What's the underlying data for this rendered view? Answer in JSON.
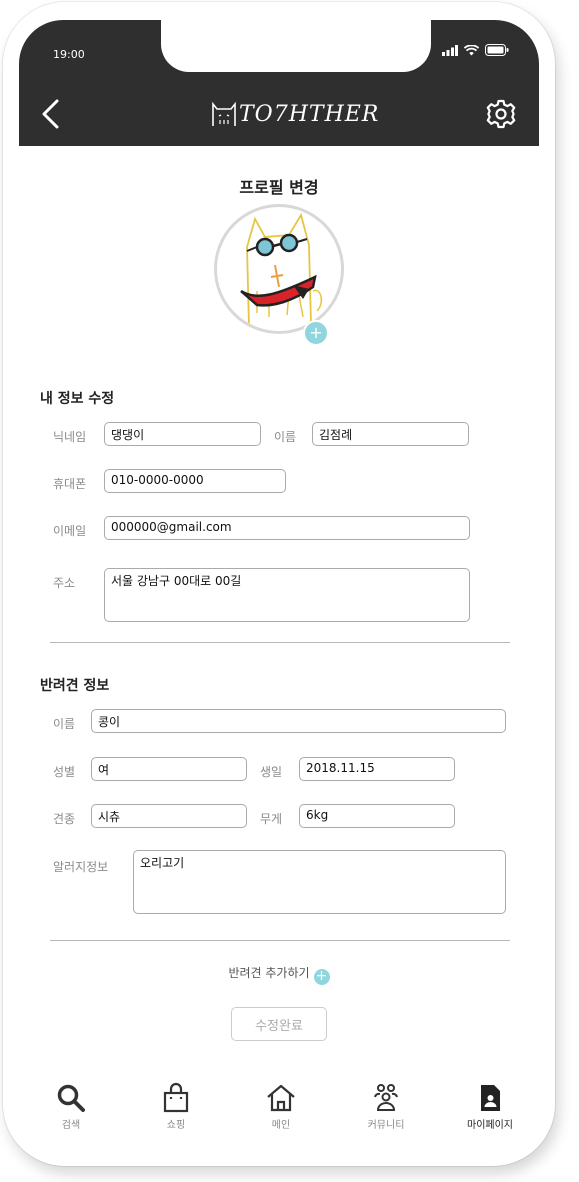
{
  "status_bar": {
    "time": "19:00"
  },
  "header": {
    "logo_text": "TO7HTHER"
  },
  "profile": {
    "title": "프로필 변경"
  },
  "my_info": {
    "section_title": "내 정보 수정",
    "nickname_label": "닉네임",
    "nickname_value": "댕댕이",
    "name_label": "이름",
    "name_value": "김점례",
    "phone_label": "휴대폰",
    "phone_value": "010-0000-0000",
    "email_label": "이메일",
    "email_value": "000000@gmail.com",
    "address_label": "주소",
    "address_value": "서울 강남구 00대로 00길"
  },
  "pet_info": {
    "section_title": "반려견 정보",
    "name_label": "이름",
    "name_value": "콩이",
    "gender_label": "성별",
    "gender_value": "여",
    "birthday_label": "생일",
    "birthday_value": "2018.11.15",
    "breed_label": "견종",
    "breed_value": "시츄",
    "weight_label": "무게",
    "weight_value": "6kg",
    "allergy_label": "알러지정보",
    "allergy_value": "오리고기"
  },
  "actions": {
    "add_pet_label": "반려견 추가하기",
    "submit_label": "수정완료"
  },
  "nav": {
    "items": [
      {
        "label": "검색",
        "icon": "search-icon"
      },
      {
        "label": "쇼핑",
        "icon": "shopping-bag-icon"
      },
      {
        "label": "메인",
        "icon": "home-icon"
      },
      {
        "label": "커뮤니티",
        "icon": "community-icon"
      },
      {
        "label": "마이페이지",
        "icon": "mypage-icon"
      }
    ],
    "active": "마이페이지"
  },
  "colors": {
    "header_bg": "#2f2f2f",
    "accent": "#8fd6df",
    "border": "#aaaaaa"
  }
}
